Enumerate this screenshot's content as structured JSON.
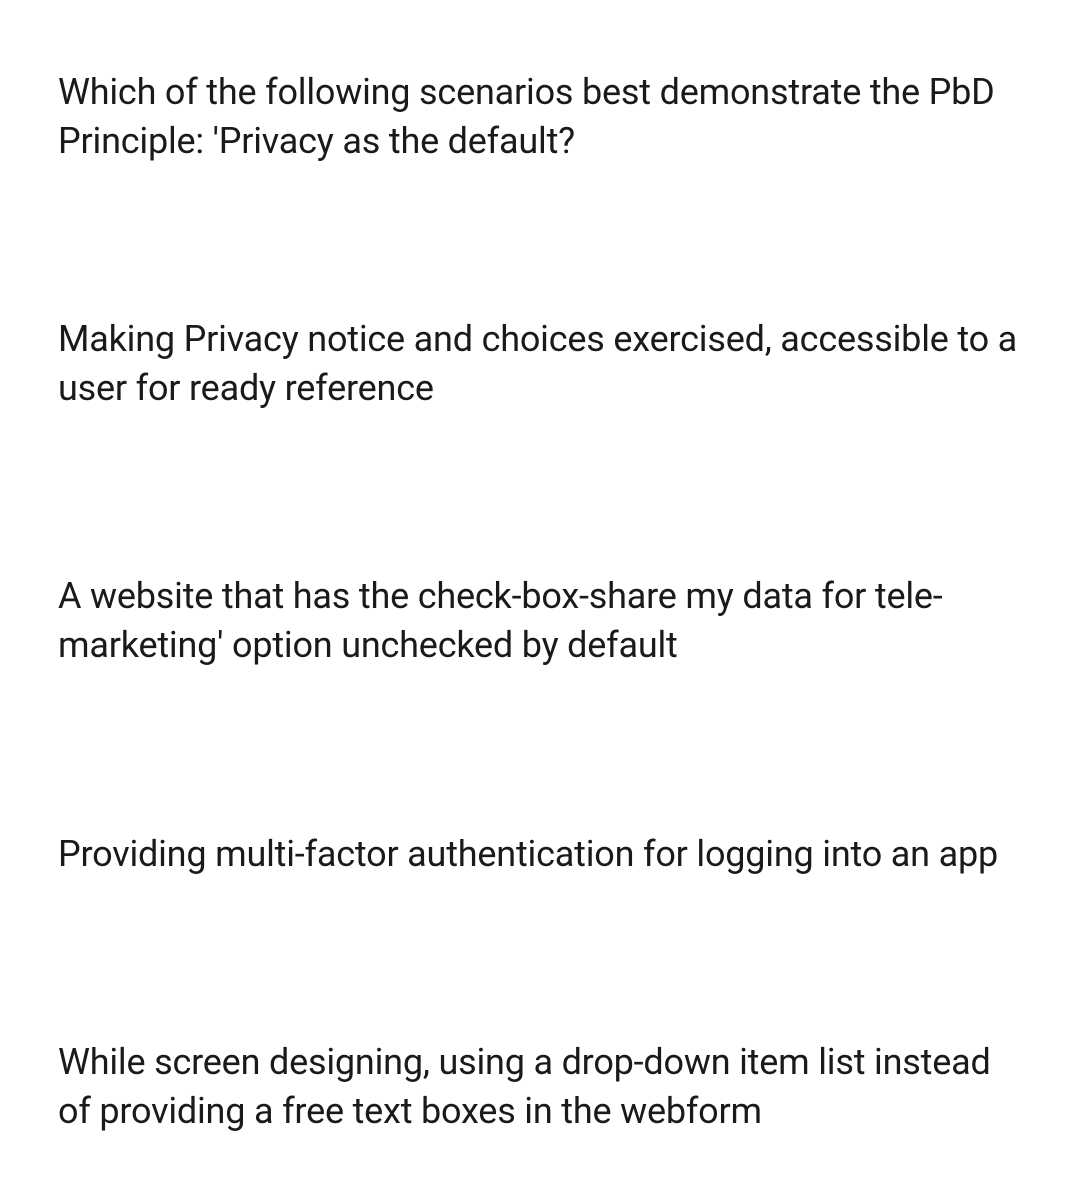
{
  "question": "Which of the following scenarios best demonstrate the PbD Principle: 'Privacy as the default?",
  "options": [
    "Making Privacy notice and choices exercised, accessible to a user for ready reference",
    "A website that has the check-box-share my data for tele-marketing' option unchecked by default",
    "Providing multi-factor authentication for logging into an app",
    "While screen designing, using a drop-down item list instead of providing a free text boxes in the webform"
  ]
}
